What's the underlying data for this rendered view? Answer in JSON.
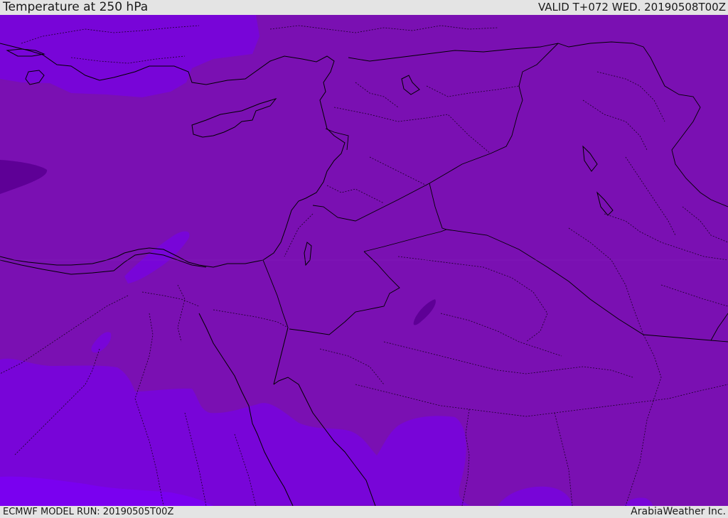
{
  "header": {
    "title": "Temperature at 250 hPa",
    "valid_time": "VALID T+072 WED. 20190508T00Z"
  },
  "footer": {
    "model_run": "ECMWF MODEL RUN: 20190505T00Z",
    "credit": "ArabiaWeather Inc."
  },
  "map": {
    "colors": {
      "background": "#7a10b2",
      "warm_band": "#7805d8",
      "warmer_band": "#7a00f0",
      "cold_pocket": "#5e0096",
      "coastline": "#000000",
      "bars": "#e4e4e4"
    }
  }
}
